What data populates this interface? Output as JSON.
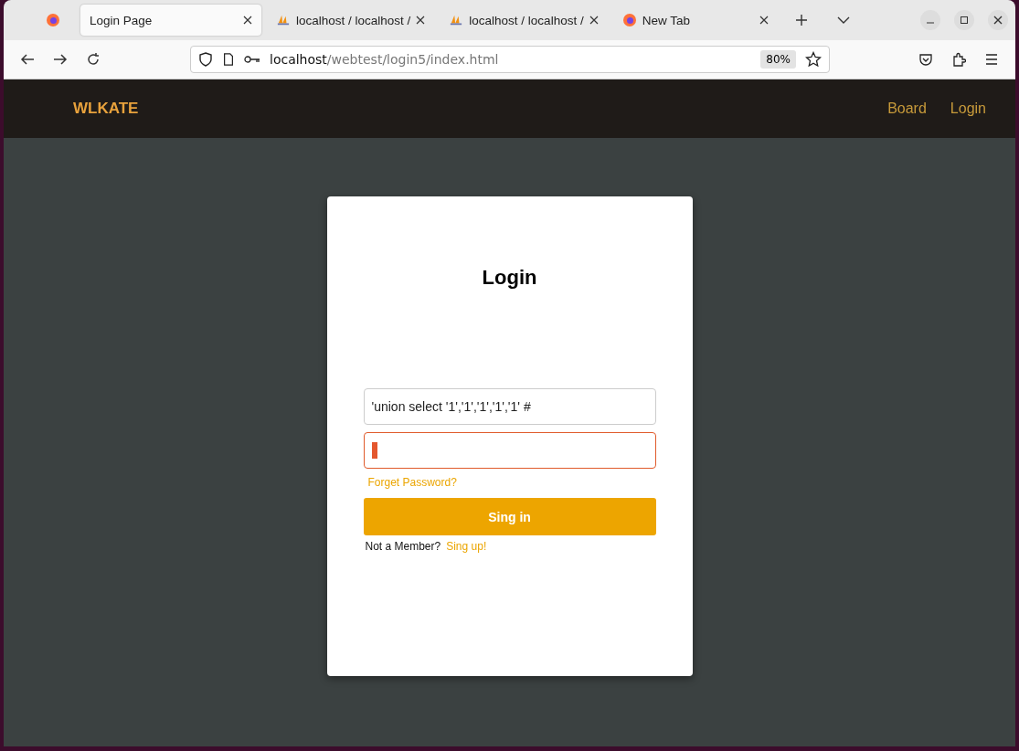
{
  "browser": {
    "tabs": [
      {
        "title": "Login Page",
        "kind": "page",
        "selected": true
      },
      {
        "title": "localhost / localhost /",
        "kind": "pma",
        "selected": false
      },
      {
        "title": "localhost / localhost /",
        "kind": "pma",
        "selected": false
      },
      {
        "title": "New Tab",
        "kind": "firefox",
        "selected": false
      }
    ],
    "url_host": "localhost",
    "url_path": "/webtest/login5/index.html",
    "zoom": "80%"
  },
  "navbar": {
    "brand": "WLKATE",
    "links": [
      "Board",
      "Login"
    ]
  },
  "login": {
    "title": "Login",
    "username": {
      "value": "'union select '1','1','1','1','1' #",
      "focused": false
    },
    "password": {
      "focused": true
    },
    "forgot": "Forget Password?",
    "submit": "Sing in",
    "member_text": "Not a Member?",
    "signup": "Sing up!"
  }
}
